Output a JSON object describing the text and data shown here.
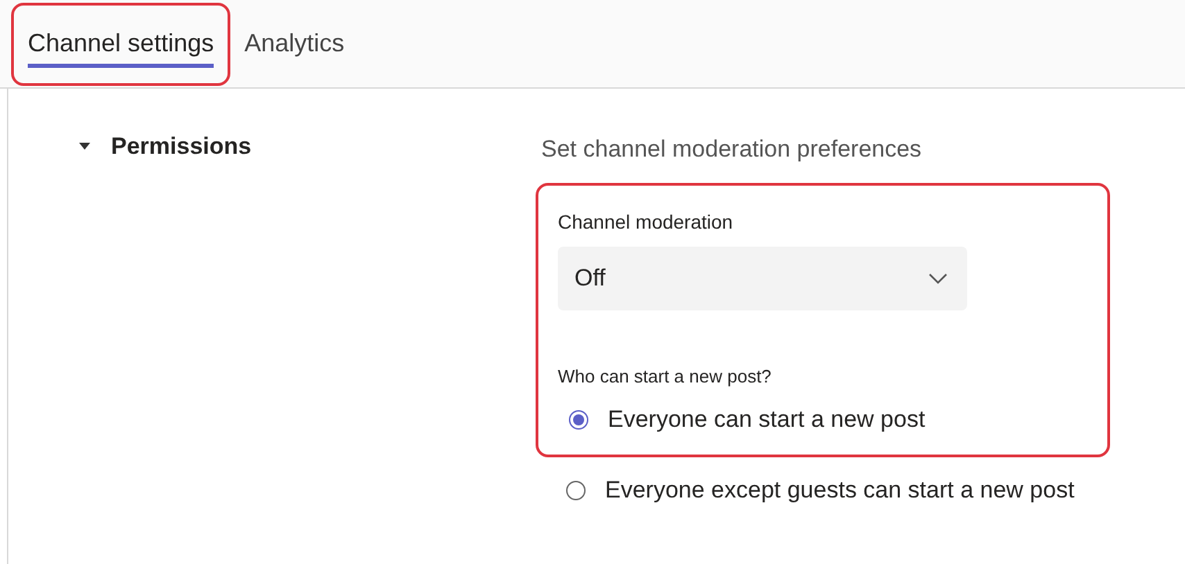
{
  "tabs": [
    {
      "label": "Channel settings",
      "selected": true,
      "highlighted": true
    },
    {
      "label": "Analytics",
      "selected": false,
      "highlighted": false
    }
  ],
  "section": {
    "title": "Permissions",
    "expanded": true,
    "description": "Set channel moderation preferences",
    "highlighted": true,
    "moderation": {
      "label": "Channel moderation",
      "value": "Off"
    },
    "question": "Who can start a new post?",
    "options": [
      {
        "label": "Everyone can start a new post",
        "selected": true,
        "highlighted": true
      },
      {
        "label": "Everyone except guests can start a new post",
        "selected": false,
        "highlighted": false
      }
    ]
  }
}
